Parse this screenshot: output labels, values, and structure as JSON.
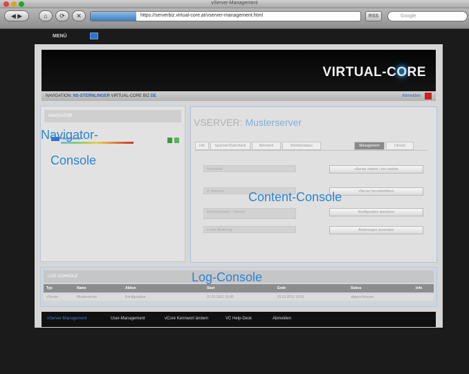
{
  "browser": {
    "window_title": "vServer-Management",
    "url": "https://serverbiz.virtual-core.at/vserver-management.html",
    "search_placeholder": "Google",
    "rss_label": "RSS",
    "back_label": "◀ ▶",
    "home_label": "⌂",
    "reload_label": "⟳",
    "stop_label": "✕"
  },
  "page": {
    "menu_label": "MENÜ",
    "brand": {
      "prefix": "VIRTUAL-C",
      "glow_letter": "O",
      "suffix": "RE"
    },
    "status": {
      "prefix": "NAVIGATION:",
      "highlight": "NS-STERNLINGER",
      "rest": "VIRTUAL-CORE BIZ",
      "tail": "DE",
      "logout_label": "Abmelden"
    }
  },
  "navigator": {
    "header": "NAVIGATOR",
    "entry_label": "Musterserver",
    "overlay_line1": "Navigator-",
    "overlay_line2": "Console"
  },
  "content": {
    "title_prefix": "VSERVER:",
    "title_name": "Musterserver",
    "tabs": [
      {
        "label": "Info"
      },
      {
        "label": "Speicher/Datenbank"
      },
      {
        "label": "Netzwerk"
      },
      {
        "label": "Betriebsstatus"
      },
      {
        "label": "Management",
        "active": true
      },
      {
        "label": "Uhrzeit"
      }
    ],
    "fields": [
      "Hostname",
      "IP-Adresse",
      "Betriebssystem / Version",
      "Letzte Änderung"
    ],
    "buttons": [
      "vServer starten / neu starten",
      "vServer herunterfahren",
      "Konfiguration speichern",
      "Änderungen anwenden"
    ],
    "overlay": "Content-Console"
  },
  "log": {
    "header": "LOG CONSOLE",
    "columns": [
      "Typ",
      "Name",
      "Aktion",
      "Start",
      "Ende",
      "Status",
      "Info"
    ],
    "row": [
      "vServer",
      "Musterserver",
      "Konfiguration",
      "01.01.2011 10:00",
      "01.01.2011 10:01",
      "abgeschlossen",
      ""
    ],
    "overlay": "Log-Console"
  },
  "footer": {
    "items": [
      {
        "label": "vServer-Management",
        "active": true
      },
      {
        "label": "User-Management"
      },
      {
        "label": "vCore Kennwort ändern"
      },
      {
        "label": "VC Help-Desk"
      },
      {
        "label": "Abmelden"
      }
    ]
  }
}
